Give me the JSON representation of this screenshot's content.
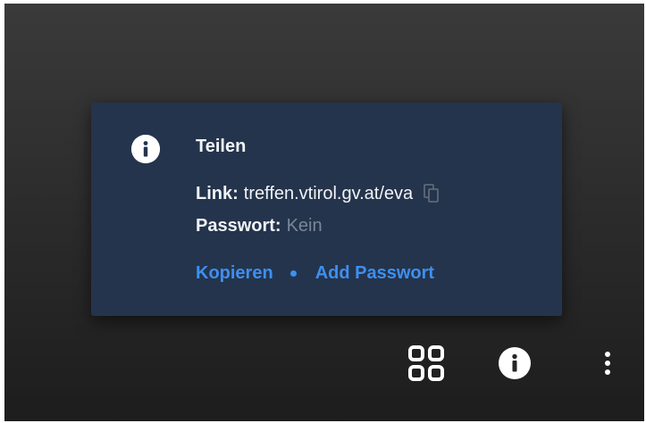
{
  "share_card": {
    "title": "Teilen",
    "link_label": "Link:",
    "link_value": "treffen.vtirol.gv.at/eva",
    "password_label": "Passwort:",
    "password_value": "Kein",
    "copy_action": "Kopieren",
    "add_password_action": "Add Passwort"
  },
  "icons": {
    "card_info": "info-icon",
    "copy": "copy-icon",
    "tile_view": "tile-view-icon",
    "toolbar_info": "info-icon",
    "more": "more-vertical-icon"
  },
  "colors": {
    "card_background": "#24344c",
    "accent": "#3d8ff2",
    "muted_text": "#7b8797",
    "text": "#f1f3f6"
  }
}
